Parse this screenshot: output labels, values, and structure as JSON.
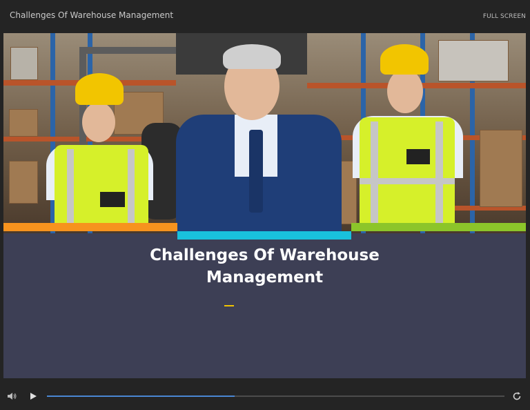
{
  "window": {
    "title": "Challenges Of Warehouse Management",
    "fullscreen_label": "FULL SCREEN"
  },
  "slide": {
    "title_line1": "Challenges Of Warehouse",
    "title_line2": "Management",
    "image": "warehouse staff photo",
    "accent_bars": {
      "left": "#f7931e",
      "center": "#19c1dc",
      "right": "#8cc52a"
    },
    "title_accent": "#f2c500",
    "background": "#3d3f55"
  },
  "player": {
    "progress_fraction": 0.41,
    "icons": [
      "volume-icon",
      "play-icon",
      "replay-icon"
    ]
  }
}
